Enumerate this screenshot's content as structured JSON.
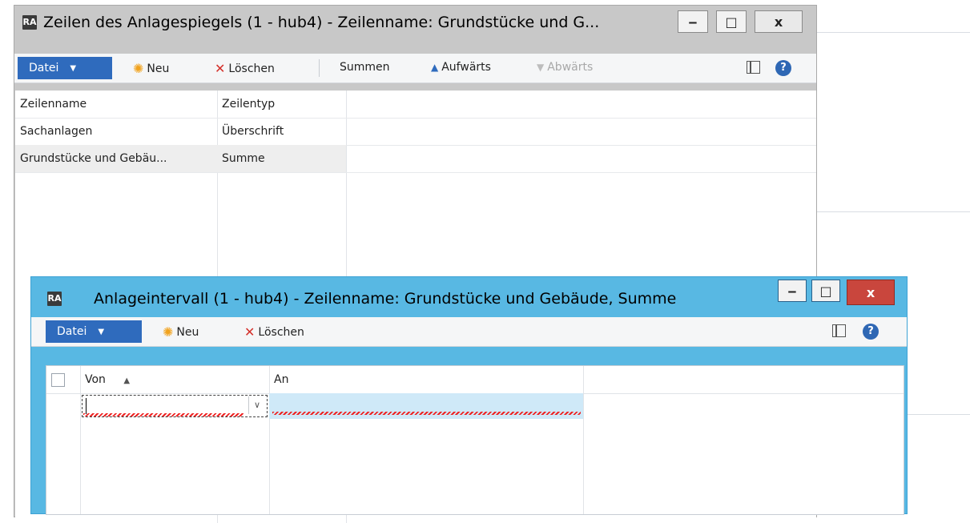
{
  "window1": {
    "title": "Zeilen des Anlagespiegels (1 - hub4) - Zeilenname: Grundstücke und G...",
    "icon_text": "RA",
    "controls": {
      "minimize": "‒",
      "maximize": "□",
      "close": "x"
    },
    "toolbar": {
      "file": "Datei",
      "new": "Neu",
      "delete": "Löschen",
      "sums": "Summen",
      "up": "Aufwärts",
      "down": "Abwärts"
    },
    "grid": {
      "headers": [
        "Zeilenname",
        "Zeilentyp"
      ],
      "rows": [
        [
          "Sachanlagen",
          "Überschrift"
        ],
        [
          "Grundstücke und Gebäu...",
          "Summe"
        ]
      ]
    }
  },
  "window2": {
    "title": "Anlageintervall (1 - hub4) - Zeilenname: Grundstücke und Gebäude, Summe",
    "icon_text": "RA",
    "controls": {
      "minimize": "‒",
      "maximize": "□",
      "close": "x"
    },
    "toolbar": {
      "file": "Datei",
      "new": "Neu",
      "delete": "Löschen"
    },
    "grid": {
      "headers": [
        "Von",
        "An"
      ],
      "sort_indicator": "▲",
      "edit_value_von": "",
      "edit_value_an": ""
    }
  },
  "colors": {
    "accent": "#2f6bbd",
    "window2_frame": "#58b8e3",
    "close_active": "#c9463d"
  }
}
